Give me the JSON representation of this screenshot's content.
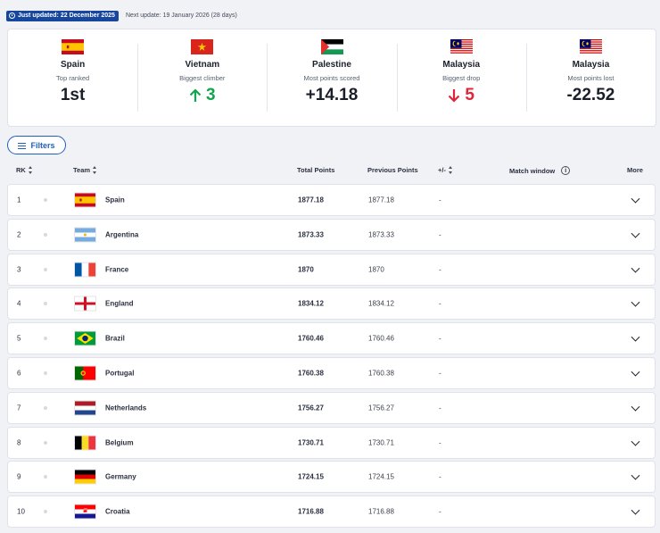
{
  "top": {
    "updated_label": "Just updated: 22 December 2025",
    "next_label": "Next update: 19 January 2026 (28 days)"
  },
  "summary": [
    {
      "country": "Spain",
      "flag": "spain-flag",
      "subtitle": "Top ranked",
      "value": "1st"
    },
    {
      "country": "Vietnam",
      "flag": "vietnam-flag",
      "subtitle": "Biggest climber",
      "value": "3",
      "trend": "up"
    },
    {
      "country": "Palestine",
      "flag": "palestine-flag",
      "subtitle": "Most points scored",
      "value": "+14.18"
    },
    {
      "country": "Malaysia",
      "flag": "malaysia-flag",
      "subtitle": "Biggest drop",
      "value": "5",
      "trend": "down"
    },
    {
      "country": "Malaysia",
      "flag": "malaysia-flag",
      "subtitle": "Most points lost",
      "value": "-22.52"
    }
  ],
  "filters_label": "Filters",
  "columns": {
    "rk": "RK",
    "team": "Team",
    "total": "Total Points",
    "previous": "Previous Points",
    "change": "+/-",
    "window": "Match window",
    "more": "More"
  },
  "rows": [
    {
      "rk": "1",
      "team": "Spain",
      "total": "1877.18",
      "previous": "1877.18",
      "change": "-",
      "flag": "spain-flag"
    },
    {
      "rk": "2",
      "team": "Argentina",
      "total": "1873.33",
      "previous": "1873.33",
      "change": "-",
      "flag": "argentina-flag"
    },
    {
      "rk": "3",
      "team": "France",
      "total": "1870",
      "previous": "1870",
      "change": "-",
      "flag": "france-flag"
    },
    {
      "rk": "4",
      "team": "England",
      "total": "1834.12",
      "previous": "1834.12",
      "change": "-",
      "flag": "england-flag"
    },
    {
      "rk": "5",
      "team": "Brazil",
      "total": "1760.46",
      "previous": "1760.46",
      "change": "-",
      "flag": "brazil-flag"
    },
    {
      "rk": "6",
      "team": "Portugal",
      "total": "1760.38",
      "previous": "1760.38",
      "change": "-",
      "flag": "portugal-flag"
    },
    {
      "rk": "7",
      "team": "Netherlands",
      "total": "1756.27",
      "previous": "1756.27",
      "change": "-",
      "flag": "netherlands-flag"
    },
    {
      "rk": "8",
      "team": "Belgium",
      "total": "1730.71",
      "previous": "1730.71",
      "change": "-",
      "flag": "belgium-flag"
    },
    {
      "rk": "9",
      "team": "Germany",
      "total": "1724.15",
      "previous": "1724.15",
      "change": "-",
      "flag": "germany-flag"
    },
    {
      "rk": "10",
      "team": "Croatia",
      "total": "1716.88",
      "previous": "1716.88",
      "change": "-",
      "flag": "croatia-flag"
    }
  ],
  "colors": {
    "brand": "#17469e",
    "accent": "#1f5fbf",
    "climb": "#14a44d",
    "drop": "#e0243a"
  }
}
